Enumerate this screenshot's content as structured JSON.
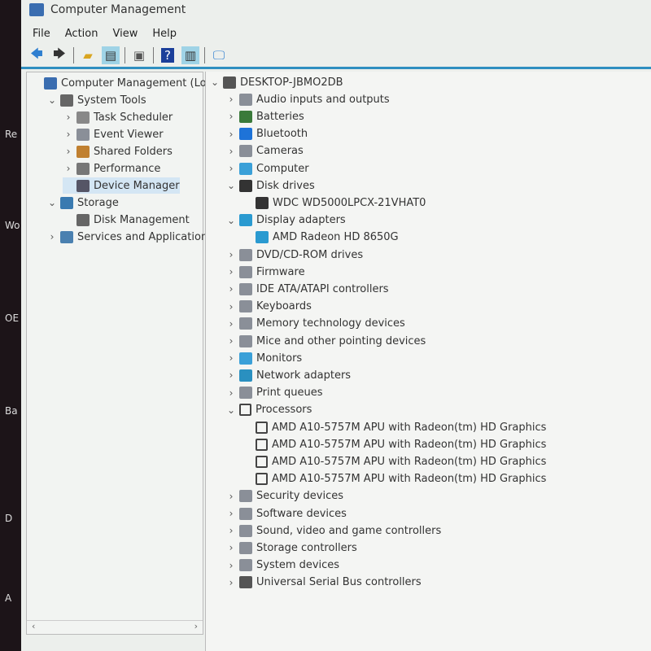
{
  "desktop": {
    "fragments": [
      "Re",
      "Wo",
      "OE",
      "Ba",
      "D",
      "A"
    ]
  },
  "window": {
    "title": "Computer Management"
  },
  "menu": [
    "File",
    "Action",
    "View",
    "Help"
  ],
  "toolbar": [
    {
      "icon": "back-arrow-icon"
    },
    {
      "icon": "forward-arrow-icon"
    },
    {
      "icon": "up-folder-icon"
    },
    {
      "icon": "show-hide-console-tree-icon",
      "active": true
    },
    {
      "icon": "properties-icon"
    },
    {
      "icon": "help-icon"
    },
    {
      "icon": "show-hide-action-pane-icon",
      "active": true
    },
    {
      "icon": "scan-hardware-icon"
    }
  ],
  "left_tree": [
    {
      "label": "Computer Management (Local",
      "level": 0,
      "chev": "",
      "icon": "computer-management-icon"
    },
    {
      "label": "System Tools",
      "level": 1,
      "chev": "down",
      "icon": "tools-icon"
    },
    {
      "label": "Task Scheduler",
      "level": 2,
      "chev": "right",
      "icon": "clock-icon"
    },
    {
      "label": "Event Viewer",
      "level": 2,
      "chev": "right",
      "icon": "event-viewer-icon"
    },
    {
      "label": "Shared Folders",
      "level": 2,
      "chev": "right",
      "icon": "shared-folder-icon"
    },
    {
      "label": "Performance",
      "level": 2,
      "chev": "right",
      "icon": "performance-icon"
    },
    {
      "label": "Device Manager",
      "level": 2,
      "chev": "",
      "icon": "device-manager-icon",
      "selected": true
    },
    {
      "label": "Storage",
      "level": 1,
      "chev": "down",
      "icon": "storage-icon"
    },
    {
      "label": "Disk Management",
      "level": 2,
      "chev": "",
      "icon": "disk-icon"
    },
    {
      "label": "Services and Applications",
      "level": 1,
      "chev": "right",
      "icon": "services-icon"
    }
  ],
  "device_tree": [
    {
      "label": "DESKTOP-JBMO2DB",
      "level": 0,
      "chev": "down",
      "icon": "computer-icon"
    },
    {
      "label": "Audio inputs and outputs",
      "level": 1,
      "chev": "right",
      "icon": "speaker-icon"
    },
    {
      "label": "Batteries",
      "level": 1,
      "chev": "right",
      "icon": "battery-icon"
    },
    {
      "label": "Bluetooth",
      "level": 1,
      "chev": "right",
      "icon": "bluetooth-icon"
    },
    {
      "label": "Cameras",
      "level": 1,
      "chev": "right",
      "icon": "camera-icon"
    },
    {
      "label": "Computer",
      "level": 1,
      "chev": "right",
      "icon": "monitor-icon"
    },
    {
      "label": "Disk drives",
      "level": 1,
      "chev": "down",
      "icon": "disk-drive-icon"
    },
    {
      "label": "WDC WD5000LPCX-21VHAT0",
      "level": 2,
      "chev": "",
      "icon": "disk-drive-icon"
    },
    {
      "label": "Display adapters",
      "level": 1,
      "chev": "down",
      "icon": "display-adapter-icon"
    },
    {
      "label": "AMD Radeon HD 8650G",
      "level": 2,
      "chev": "",
      "icon": "display-adapter-icon"
    },
    {
      "label": "DVD/CD-ROM drives",
      "level": 1,
      "chev": "right",
      "icon": "dvd-icon"
    },
    {
      "label": "Firmware",
      "level": 1,
      "chev": "right",
      "icon": "firmware-icon"
    },
    {
      "label": "IDE ATA/ATAPI controllers",
      "level": 1,
      "chev": "right",
      "icon": "ide-controller-icon"
    },
    {
      "label": "Keyboards",
      "level": 1,
      "chev": "right",
      "icon": "keyboard-icon"
    },
    {
      "label": "Memory technology devices",
      "level": 1,
      "chev": "right",
      "icon": "memory-icon"
    },
    {
      "label": "Mice and other pointing devices",
      "level": 1,
      "chev": "right",
      "icon": "mouse-icon"
    },
    {
      "label": "Monitors",
      "level": 1,
      "chev": "right",
      "icon": "monitor-icon"
    },
    {
      "label": "Network adapters",
      "level": 1,
      "chev": "right",
      "icon": "network-icon"
    },
    {
      "label": "Print queues",
      "level": 1,
      "chev": "right",
      "icon": "printer-icon"
    },
    {
      "label": "Processors",
      "level": 1,
      "chev": "down",
      "icon": "processor-icon"
    },
    {
      "label": "AMD A10-5757M APU with Radeon(tm) HD Graphics",
      "level": 2,
      "chev": "",
      "icon": "processor-icon"
    },
    {
      "label": "AMD A10-5757M APU with Radeon(tm) HD Graphics",
      "level": 2,
      "chev": "",
      "icon": "processor-icon"
    },
    {
      "label": "AMD A10-5757M APU with Radeon(tm) HD Graphics",
      "level": 2,
      "chev": "",
      "icon": "processor-icon"
    },
    {
      "label": "AMD A10-5757M APU with Radeon(tm) HD Graphics",
      "level": 2,
      "chev": "",
      "icon": "processor-icon"
    },
    {
      "label": "Security devices",
      "level": 1,
      "chev": "right",
      "icon": "security-icon"
    },
    {
      "label": "Software devices",
      "level": 1,
      "chev": "right",
      "icon": "software-device-icon"
    },
    {
      "label": "Sound, video and game controllers",
      "level": 1,
      "chev": "right",
      "icon": "sound-icon"
    },
    {
      "label": "Storage controllers",
      "level": 1,
      "chev": "right",
      "icon": "storage-controller-icon"
    },
    {
      "label": "System devices",
      "level": 1,
      "chev": "right",
      "icon": "system-devices-icon"
    },
    {
      "label": "Universal Serial Bus controllers",
      "level": 1,
      "chev": "right",
      "icon": "usb-icon"
    }
  ],
  "colors": {
    "accent": "#2f8fc0",
    "selection": "#d4e6f4"
  }
}
